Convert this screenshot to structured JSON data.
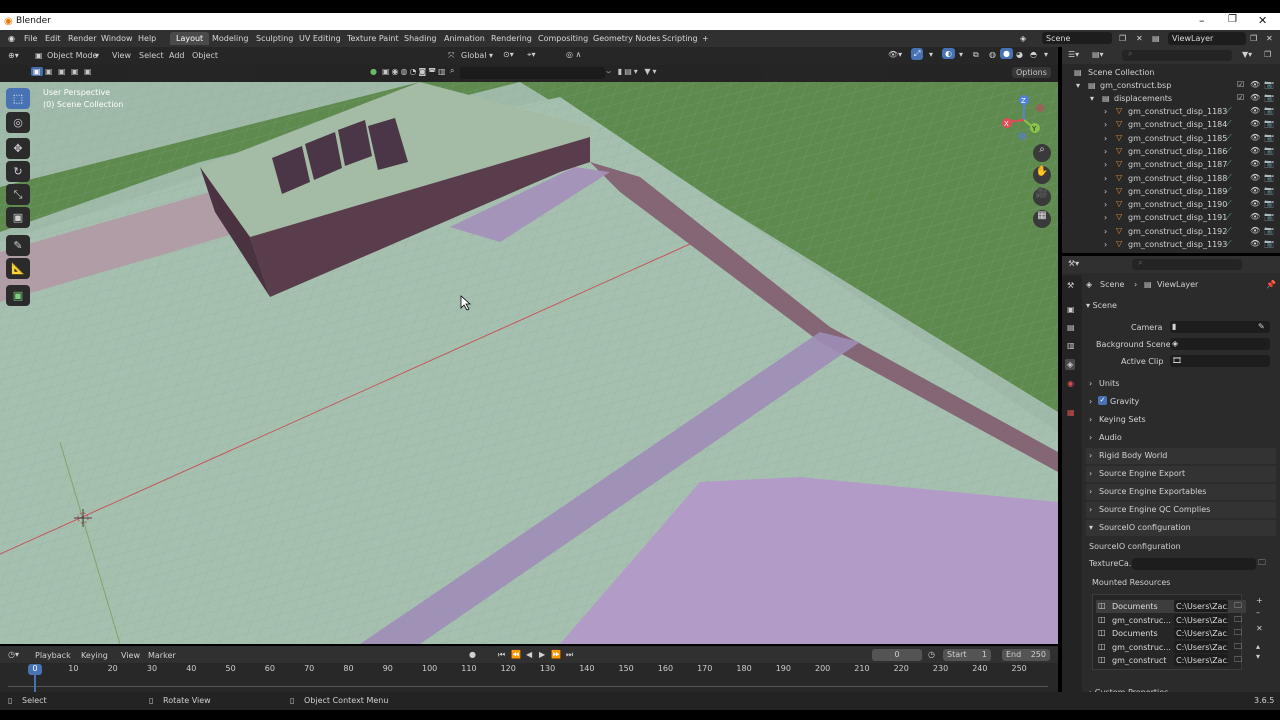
{
  "app": {
    "title": "Blender",
    "version": "3.6.5"
  },
  "menu": [
    "File",
    "Edit",
    "Render",
    "Window",
    "Help"
  ],
  "workspaces": [
    "Layout",
    "Modeling",
    "Sculpting",
    "UV Editing",
    "Texture Paint",
    "Shading",
    "Animation",
    "Rendering",
    "Compositing",
    "Geometry Nodes",
    "Scripting"
  ],
  "active_workspace": "Layout",
  "scene_selector": "Scene",
  "viewlayer_selector": "ViewLayer",
  "viewport": {
    "mode": "Object Mode",
    "menus": [
      "View",
      "Select",
      "Add",
      "Object"
    ],
    "transform_orientation": "Global",
    "options_label": "Options",
    "overlay_line1": "User Perspective",
    "overlay_line2": "(0) Scene Collection"
  },
  "outliner": {
    "root": "Scene Collection",
    "collection": "gm_construct.bsp",
    "subcollection": "displacements",
    "items": [
      "gm_construct_disp_1183",
      "gm_construct_disp_1184",
      "gm_construct_disp_1185",
      "gm_construct_disp_1186",
      "gm_construct_disp_1187",
      "gm_construct_disp_1188",
      "gm_construct_disp_1189",
      "gm_construct_disp_1190",
      "gm_construct_disp_1191",
      "gm_construct_disp_1192",
      "gm_construct_disp_1193"
    ]
  },
  "properties": {
    "breadcrumb_scene": "Scene",
    "breadcrumb_viewlayer": "ViewLayer",
    "scene_panel": "Scene",
    "camera_label": "Camera",
    "background_scene_label": "Background Scene",
    "active_clip_label": "Active Clip",
    "panels": [
      "Units",
      "Gravity",
      "Keying Sets",
      "Audio",
      "Rigid Body World",
      "Source Engine Export",
      "Source Engine Exportables",
      "Source Engine QC Complies",
      "SourceIO configuration"
    ],
    "gravity_checked": true,
    "sourceio_title": "SourceIO configuration",
    "texture_cache_label": "TextureCa...",
    "mounted_resources_label": "Mounted Resources",
    "resources": [
      {
        "name": "Documents",
        "path": "C:\\Users\\Zac..."
      },
      {
        "name": "gm_construc...",
        "path": "C:\\Users\\Zac..."
      },
      {
        "name": "Documents",
        "path": "C:\\Users\\Zac..."
      },
      {
        "name": "gm_construc...",
        "path": "C:\\Users\\Zac..."
      },
      {
        "name": "gm_construct",
        "path": "C:\\Users\\Zac..."
      }
    ],
    "custom_properties": "Custom Properties"
  },
  "timeline": {
    "menus": [
      "Playback",
      "Keying",
      "View",
      "Marker"
    ],
    "current_frame": "0",
    "start_label": "Start",
    "start_value": "1",
    "end_label": "End",
    "end_value": "250",
    "ticks": [
      "0",
      "10",
      "20",
      "30",
      "40",
      "50",
      "60",
      "70",
      "80",
      "90",
      "100",
      "110",
      "120",
      "130",
      "140",
      "150",
      "160",
      "170",
      "180",
      "190",
      "200",
      "210",
      "220",
      "230",
      "240",
      "250"
    ]
  },
  "status": {
    "select": "Select",
    "rotate": "Rotate View",
    "context": "Object Context Menu"
  },
  "colors": {
    "accent": "#4772b3",
    "viewport_floor": "#9fbaa8",
    "wall": "#5a3d4c",
    "grass": "#5e8a4e",
    "terrain": "#b39bc8"
  }
}
